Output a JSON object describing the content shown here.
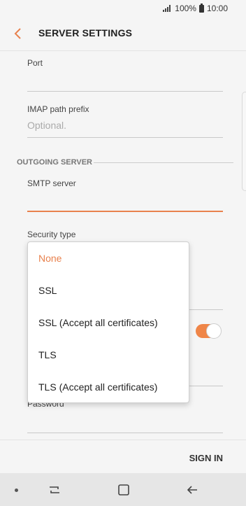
{
  "status_bar": {
    "battery_percent": "100%",
    "time": "10:00"
  },
  "header": {
    "title": "SERVER SETTINGS"
  },
  "form": {
    "port_label": "Port",
    "imap_prefix_label": "IMAP path prefix",
    "imap_prefix_placeholder": "Optional.",
    "outgoing_section": "OUTGOING SERVER",
    "smtp_server_label": "SMTP server",
    "security_type_label": "Security type",
    "password_label": "Password",
    "toggle_on": true
  },
  "security_dropdown": {
    "selected": "None",
    "options": [
      "None",
      "SSL",
      "SSL (Accept all certificates)",
      "TLS",
      "TLS (Accept all certificates)"
    ]
  },
  "footer": {
    "sign_in_label": "SIGN IN"
  },
  "icons": {
    "back": "back-arrow-icon",
    "signal": "signal-icon",
    "battery": "battery-icon",
    "nav_recents": "recents-icon",
    "nav_home": "home-icon",
    "nav_back": "nav-back-icon"
  },
  "colors": {
    "accent": "#e8814d",
    "toggle": "#ef8548"
  }
}
